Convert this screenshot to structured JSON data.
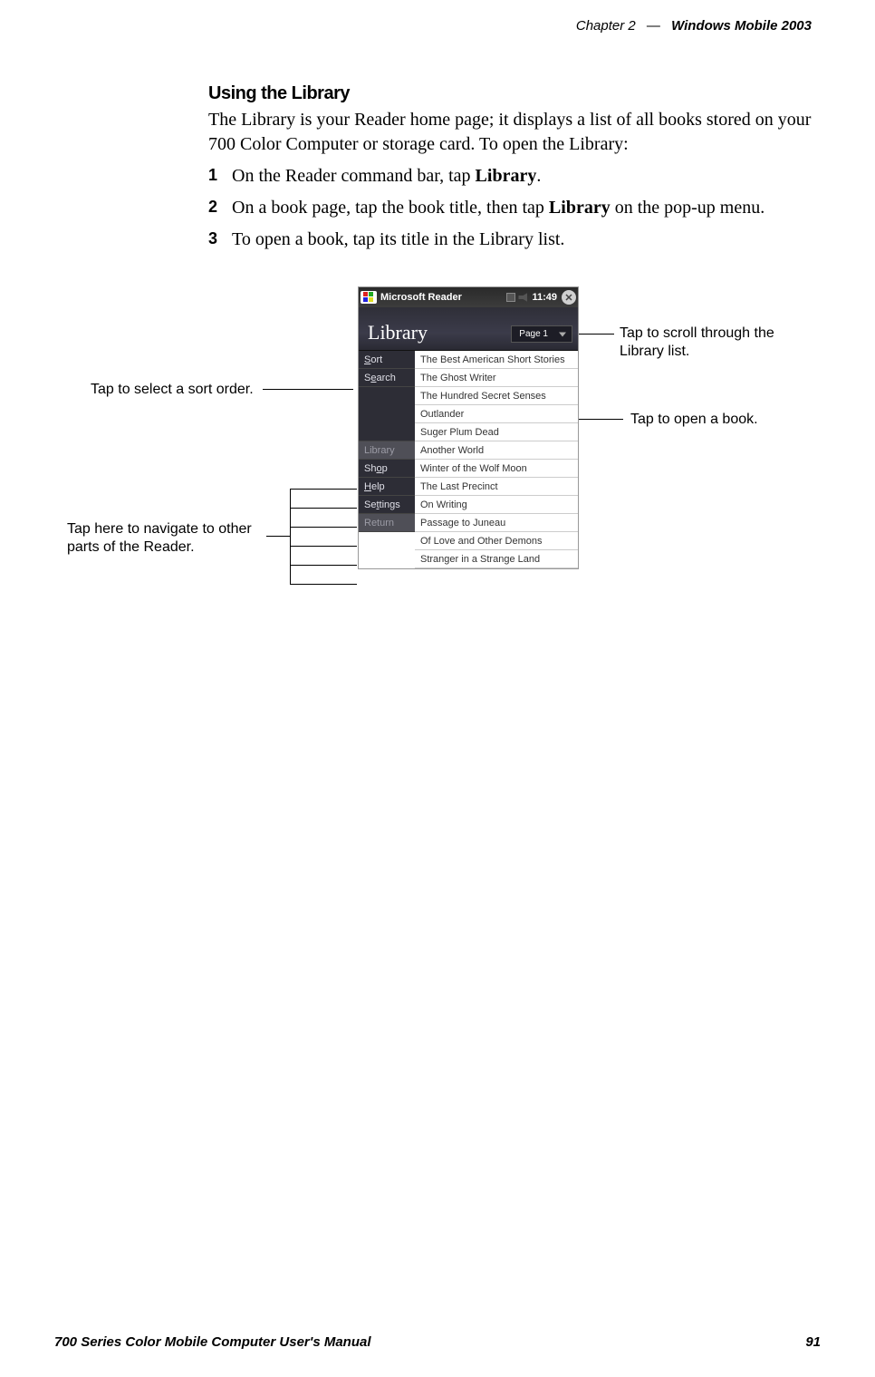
{
  "header": {
    "chapter": "Chapter 2",
    "dash": "—",
    "title": "Windows Mobile 2003"
  },
  "section": {
    "title": "Using the Library",
    "intro": "The Library is your Reader home page; it displays a list of all books stored on your 700 Color Computer or storage card. To open the Library:",
    "steps": [
      {
        "num": "1",
        "pre": "On the Reader command bar, tap ",
        "bold": "Library",
        "post": "."
      },
      {
        "num": "2",
        "pre": "On a book page, tap the book title, then tap ",
        "bold": "Library",
        "post": " on the pop-up menu."
      },
      {
        "num": "3",
        "pre": "To open a book, tap its title in the Library list.",
        "bold": "",
        "post": ""
      }
    ]
  },
  "device": {
    "titlebar": {
      "app": "Microsoft Reader",
      "time": "11:49"
    },
    "library_title": "Library",
    "page_indicator": "Page 1",
    "sidebar": {
      "sort": "Sort",
      "search": "Search",
      "library": "Library",
      "shop": "Shop",
      "help": "Help",
      "settings": "Settings",
      "return": "Return"
    },
    "books": [
      "The Best American Short Stories",
      "The Ghost Writer",
      "The Hundred Secret Senses",
      "Outlander",
      "Suger Plum Dead",
      "Another World",
      "Winter of the Wolf Moon",
      "The Last Precinct",
      "On Writing",
      "Passage to Juneau",
      "Of Love and Other Demons",
      "Stranger in a Strange Land"
    ]
  },
  "callouts": {
    "sort": "Tap to select a sort order.",
    "nav": "Tap here to navigate to other parts of the Reader.",
    "scroll": "Tap to scroll through the Library list.",
    "open": "Tap to open a book."
  },
  "footer": {
    "manual": "700 Series Color Mobile Computer User's Manual",
    "page": "91"
  }
}
